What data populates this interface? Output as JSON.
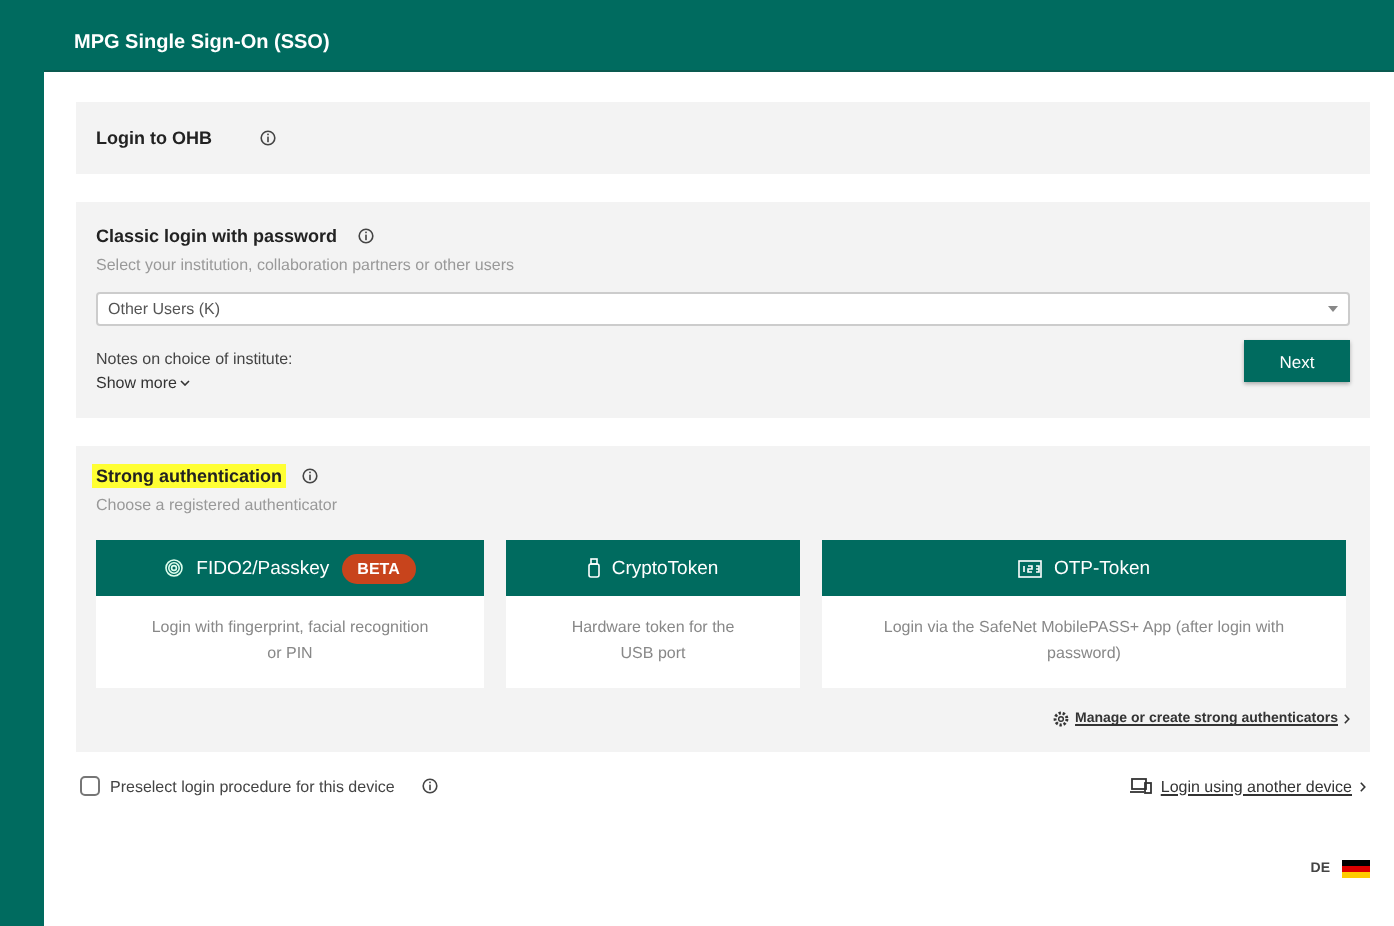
{
  "window": {
    "title": "MPG Single Sign-On (SSO)"
  },
  "ohb": {
    "title": "Login to OHB"
  },
  "classic": {
    "title": "Classic login with password",
    "subtitle": "Select your institution, collaboration partners or other users",
    "select_value": "Other Users (K)",
    "notes": "Notes on choice of institute:",
    "show_more": "Show more",
    "next": "Next"
  },
  "strong": {
    "title": "Strong authentication",
    "highlighted": true,
    "subtitle": "Choose a registered authenticator",
    "methods": [
      {
        "kind": "fingerprint",
        "label": "FIDO2/Passkey",
        "badge": "BETA",
        "description": "Login with fingerprint, facial recognition or PIN"
      },
      {
        "kind": "usb",
        "label": "CryptoToken",
        "description": "Hardware token for the USB port"
      },
      {
        "kind": "otp",
        "label": "OTP-Token",
        "description": "Login via the SafeNet MobilePASS+ App (after login with password)"
      }
    ],
    "manage_link": "Manage or create strong authenticators"
  },
  "preselect": {
    "label": "Preselect login procedure for this device",
    "checked": false
  },
  "other_device_link": "Login using another device",
  "language": "DE"
}
